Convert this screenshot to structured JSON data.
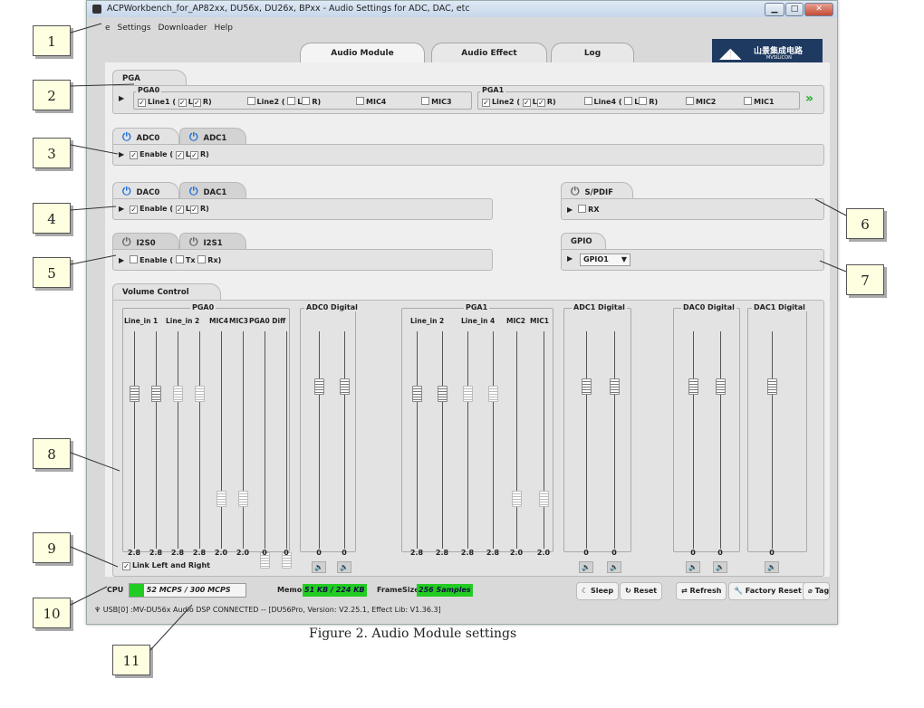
{
  "window": {
    "title": "ACPWorkbench_for_AP82xx, DU56x, DU26x, BPxx - Audio Settings for ADC, DAC, etc",
    "minimize": "▁",
    "maximize": "□",
    "close": "✕"
  },
  "menu": [
    "e",
    "Settings",
    "Downloader",
    "Help"
  ],
  "tabs": [
    "Audio Module",
    "Audio Effect",
    "Log"
  ],
  "logo": {
    "text": "山景集成电路",
    "sub": "MVSILICON"
  },
  "pga": {
    "tab": "PGA",
    "pga0": {
      "title": "PGA0",
      "items": [
        "Line1",
        "L",
        "R)",
        "Line2",
        "L",
        "R)",
        "MIC4",
        "MIC3"
      ]
    },
    "pga1": {
      "title": "PGA1",
      "items": [
        "Line2",
        "L",
        "R)",
        "Line4",
        "L",
        "R)",
        "MIC2",
        "MIC1"
      ]
    },
    "more": "»"
  },
  "adc": {
    "tabs": [
      "ADC0",
      "ADC1"
    ],
    "row": [
      "Enable (",
      "L",
      "R)"
    ]
  },
  "dac": {
    "tabs": [
      "DAC0",
      "DAC1"
    ],
    "row": [
      "Enable (",
      "L",
      "R)"
    ]
  },
  "spdif": {
    "tab": "S/PDIF",
    "row": "RX"
  },
  "i2s": {
    "tabs": [
      "I2S0",
      "I2S1"
    ],
    "row": [
      "Enable (",
      "Tx",
      "Rx)"
    ]
  },
  "gpio": {
    "tab": "GPIO",
    "value": "GPIO1"
  },
  "volume": {
    "tab": "Volume Control",
    "groups": {
      "pga0": "PGA0",
      "adc0": "ADC0 Digital",
      "pga1": "PGA1",
      "adc1": "ADC1 Digital",
      "dac0": "DAC0 Digital",
      "dac1": "DAC1 Digital"
    },
    "pga0_labels": [
      "Line_in 1",
      "Line_in 2",
      "MIC4",
      "MIC3",
      "PGA0 Diff"
    ],
    "pga1_labels": [
      "Line_in 2",
      "Line_in 4",
      "MIC2",
      "MIC1"
    ],
    "values": {
      "pga0": [
        "2.8",
        "2.8",
        "2.8",
        "2.8",
        "2.0",
        "2.0",
        "0",
        "0"
      ],
      "adc0": [
        "0",
        "0"
      ],
      "pga1": [
        "2.8",
        "2.8",
        "2.8",
        "2.8",
        "2.0",
        "2.0"
      ],
      "adc1": [
        "0",
        "0"
      ],
      "dac0": [
        "0",
        "0"
      ],
      "dac1": [
        "0"
      ]
    },
    "link": "Link Left and Right"
  },
  "status": {
    "cpu_label": "CPU",
    "cpu": "52 MCPS / 300 MCPS",
    "mem_label": "Memory",
    "mem": "51 KB / 224 KB",
    "frame_label": "FrameSize",
    "frame": "256 Samples",
    "buttons": [
      "Sleep",
      "Reset",
      "Refresh",
      "Factory Reset",
      "Tag..."
    ],
    "usb": "USB[0] :MV-DU56x Audio DSP CONNECTED -- [DU56Pro,  Version: V2.25.1,  Effect Lib: V1.36.3]"
  },
  "caption": "Figure 2. Audio Module settings",
  "callouts": [
    "1",
    "2",
    "3",
    "4",
    "5",
    "6",
    "7",
    "8",
    "9",
    "10",
    "11"
  ]
}
